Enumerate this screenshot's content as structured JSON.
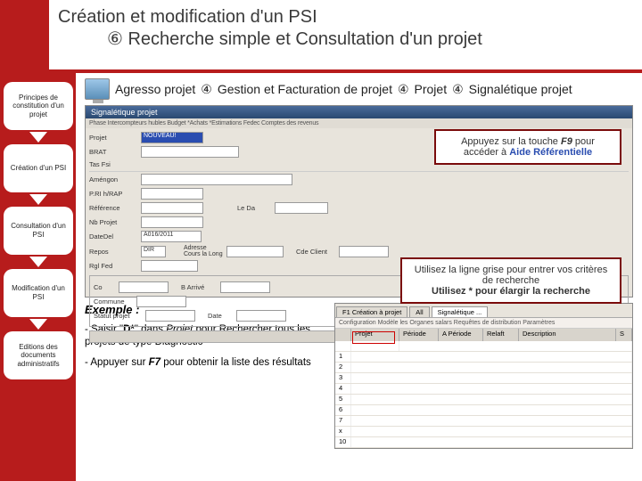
{
  "header": {
    "title": "Création et modification d'un PSI",
    "subtitle": "⑥ Recherche simple et Consultation d'un projet"
  },
  "breadcrumb": {
    "parts": [
      "Agresso projet",
      "④",
      "Gestion et Facturation de projet",
      "④",
      "Projet",
      "④",
      "Signalétique projet"
    ]
  },
  "sidebar": {
    "items": [
      "Principes de constitution d'un projet",
      "Création d'un PSI",
      "Consultation d'un PSI",
      "Modification d'un PSI",
      "Editions des documents administratifs"
    ]
  },
  "appshot": {
    "title": "Signalétique projet",
    "tabs": "Phase  Intercompteurs hubles  Budget  *Achats  *Estimations Fedec  Comptes des revenus",
    "fields": {
      "projet": "Projet",
      "BRAT": "BRAT",
      "tasfsi": "Tas Fsi",
      "projval": "NOUVEAU!",
      "amen": "Améngon",
      "prinrap": "P.RI h/RAP",
      "reference": "Référence",
      "nbprojet": "Nb Projet",
      "datedel": "DateDel",
      "datefin": "A016/2011",
      "leda": "Le Da",
      "repos": "Repos",
      "dir": "DIR",
      "rglfed": "Rgl Fed",
      "adlbl": "Adresse Cours la Long",
      "cdeclient": "Cde Client",
      "co": "Co",
      "commune": "Commune",
      "statut": "Statut projet",
      "arrive": "B Arrivé",
      "date": "Date"
    }
  },
  "callouts": {
    "c1a": "Appuyez sur la touche ",
    "c1key": "F9",
    "c1b": " pour accéder à ",
    "c1link": "Aide Référentielle",
    "c2a": "Utilisez la ligne grise pour entrer vos critères de recherche",
    "c2b": "Utilisez * pour élargir la recherche"
  },
  "example": {
    "heading": "Exemple :",
    "line1a": "- Saisir \"",
    "line1b": "D*",
    "line1c": "\" dans ",
    "line1d": "Projet",
    "line1e": " pour Rechercher tous les projets de type Diagnostic",
    "line2a": "- Appuyer sur ",
    "line2b": "F7",
    "line2c": " pour obtenir la liste des résultats"
  },
  "table": {
    "tabs": [
      "F1 Création à projet",
      "All",
      "Signalétique ..."
    ],
    "info": "Configuration  Modèle                                                                                        les Organes salars          Requêtes de distribution  Paramètres",
    "headers": [
      "",
      "Projet",
      "Période",
      "A Période",
      "Relaft",
      "Description",
      "S"
    ],
    "rows": [
      "",
      "1",
      "2",
      "3",
      "4",
      "5",
      "6",
      "7",
      "x",
      "10"
    ]
  }
}
